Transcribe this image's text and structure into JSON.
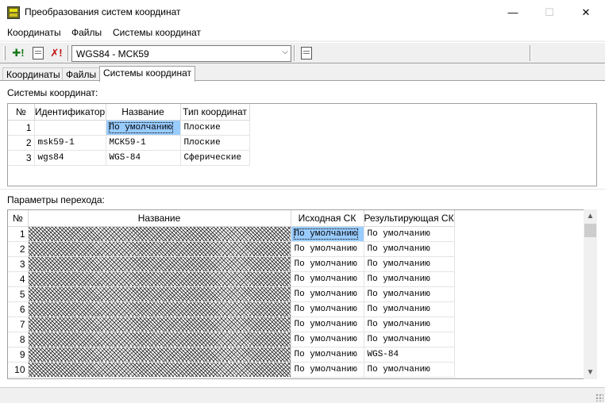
{
  "window": {
    "title": "Преобразования систем координат",
    "minimize_glyph": "—",
    "maximize_glyph": "☐",
    "close_glyph": "✕"
  },
  "menu": [
    "Координаты",
    "Файлы",
    "Системы координат"
  ],
  "toolbar": {
    "add_glyph": "✚!",
    "delete_glyph": "✗!",
    "combo_value": "WGS84 - МСК59",
    "combo_arrow": "⌵"
  },
  "tabs": [
    "Координаты",
    "Файлы",
    "Системы координат"
  ],
  "active_tab": 2,
  "systems": {
    "label": "Системы координат:",
    "headers": [
      "№",
      "Идентификатор",
      "Название",
      "Тип координат"
    ],
    "rows": [
      {
        "num": "1",
        "id": "",
        "name": "По умолчанию",
        "type": "Плоские"
      },
      {
        "num": "2",
        "id": "msk59-1",
        "name": "МСК59-1",
        "type": "Плоские"
      },
      {
        "num": "3",
        "id": "wgs84",
        "name": "WGS-84",
        "type": "Сферические"
      }
    ]
  },
  "transitions": {
    "label": "Параметры перехода:",
    "headers": [
      "№",
      "Название",
      "Исходная СК",
      "Результирующая СК"
    ],
    "rows": [
      {
        "num": "1",
        "source": "По умолчанию",
        "target": "По умолчанию"
      },
      {
        "num": "2",
        "source": "По умолчанию",
        "target": "По умолчанию"
      },
      {
        "num": "3",
        "source": "По умолчанию",
        "target": "По умолчанию"
      },
      {
        "num": "4",
        "source": "По умолчанию",
        "target": "По умолчанию"
      },
      {
        "num": "5",
        "source": "По умолчанию",
        "target": "По умолчанию"
      },
      {
        "num": "6",
        "source": "По умолчанию",
        "target": "По умолчанию"
      },
      {
        "num": "7",
        "source": "По умолчанию",
        "target": "По умолчанию"
      },
      {
        "num": "8",
        "source": "По умолчанию",
        "target": "По умолчанию"
      },
      {
        "num": "9",
        "source": "По умолчанию",
        "target": "WGS-84"
      },
      {
        "num": "10",
        "source": "По умолчанию",
        "target": "По умолчанию"
      }
    ]
  },
  "scroll": {
    "up": "▲",
    "down": "▼"
  }
}
